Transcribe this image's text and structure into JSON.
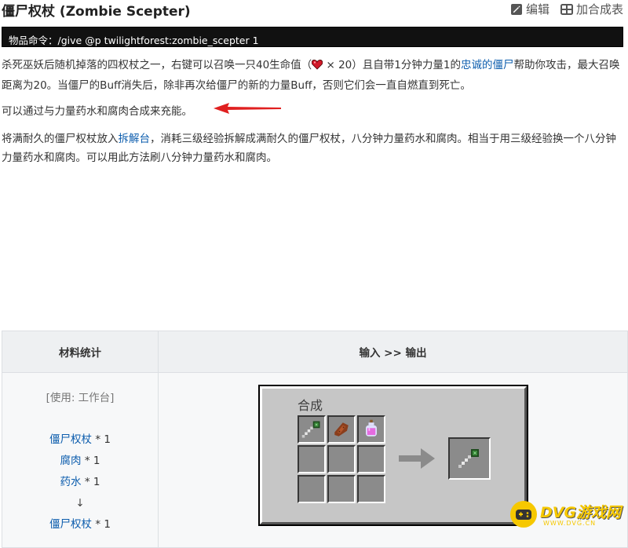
{
  "header": {
    "title": "僵尸权杖 (Zombie Scepter)",
    "edit_label": "编辑",
    "add_table_label": "加合成表"
  },
  "command": {
    "prefix": "物品命令：",
    "text": "/give @p twilightforest:zombie_scepter 1"
  },
  "paragraphs": {
    "p1_part1": "杀死巫妖后随机掉落的四权杖之一，右键可以召唤一只40生命值（",
    "p1_heart_count": "× 20",
    "p1_part2": "）且自带1分钟力量1的",
    "p1_link": "忠诚的僵尸",
    "p1_part3": "帮助你攻击，最大召唤距离为20。当僵尸的Buff消失后，除非再次给僵尸的新的力量Buff，否则它们会一直自燃直到死亡。",
    "p2": "可以通过与力量药水和腐肉合成来充能。",
    "p3_part1": "将满耐久的僵尸权杖放入",
    "p3_link": "拆解台",
    "p3_part2": "，消耗三级经验拆解成满耐久的僵尸权杖，八分钟力量药水和腐肉。相当于用三级经验换一个八分钟力量药水和腐肉。可以用此方法刷八分钟力量药水和腐肉。"
  },
  "recipe": {
    "col_materials": "材料统计",
    "col_io": "输入 >> 输出",
    "use_station": "[使用: 工作台]",
    "materials": [
      {
        "name": "僵尸权杖",
        "qty": " * 1"
      },
      {
        "name": "腐肉",
        "qty": " * 1"
      },
      {
        "name": "药水",
        "qty": " * 1"
      }
    ],
    "down_arrow": "↓",
    "output": {
      "name": "僵尸权杖",
      "qty": " * 1"
    },
    "gui_label": "合成",
    "grid": [
      "zombie-scepter",
      "rotten-flesh",
      "potion",
      "",
      "",
      "",
      "",
      "",
      ""
    ],
    "result": "zombie-scepter"
  },
  "watermark": {
    "text": "DVG游戏网",
    "url": "WWW.DVG.CN"
  },
  "colors": {
    "link": "#0b5cad",
    "annotation_arrow": "#e02020",
    "command_bg": "#111111",
    "watermark": "#f6c800"
  }
}
